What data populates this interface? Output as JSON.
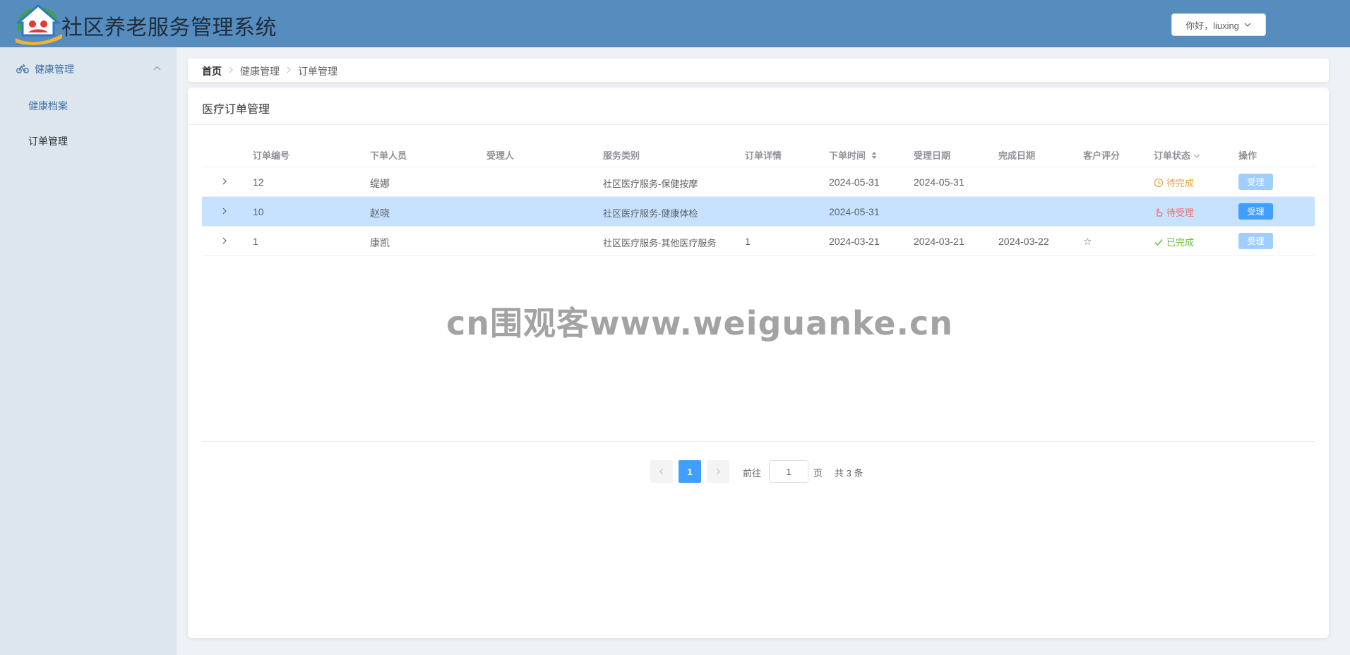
{
  "header": {
    "title": "社区养老服务管理系统",
    "user_greeting": "你好，liuxing",
    "bg_color": "#568cbe"
  },
  "sidebar": {
    "group_label": "健康管理",
    "group_icon": "bike-icon",
    "items": [
      {
        "label": "健康档案"
      },
      {
        "label": "订单管理"
      }
    ]
  },
  "breadcrumb": [
    "首页",
    "健康管理",
    "订单管理"
  ],
  "card": {
    "title": "医疗订单管理"
  },
  "table": {
    "columns": [
      "订单编号",
      "下单人员",
      "受理人",
      "服务类别",
      "订单详情",
      "下单时间",
      "受理日期",
      "完成日期",
      "客户评分",
      "订单状态",
      "操作"
    ],
    "rows": [
      {
        "id": "12",
        "customer": "缇娜",
        "handler": "",
        "category": "社区医疗服务-保健按摩",
        "detail": "",
        "order_time": "2024-05-31",
        "accept_date": "2024-05-31",
        "finish_date": "",
        "rating": "",
        "status": "待完成",
        "status_color": "#e6a23c",
        "action": "受理"
      },
      {
        "id": "10",
        "customer": "赵晓",
        "handler": "",
        "category": "社区医疗服务-健康体检",
        "detail": "",
        "order_time": "2024-05-31",
        "accept_date": "",
        "finish_date": "",
        "rating": "",
        "status": "待受理",
        "status_color": "#f56c6c",
        "action": "受理"
      },
      {
        "id": "1",
        "customer": "康凯",
        "handler": "",
        "category": "社区医疗服务-其他医疗服务",
        "detail": "1",
        "order_time": "2024-03-21",
        "accept_date": "2024-03-21",
        "finish_date": "2024-03-22",
        "rating": "☆",
        "status": "已完成",
        "status_color": "#67c23a",
        "action": "受理"
      }
    ]
  },
  "pagination": {
    "current_page": "1",
    "goto_label": "前往",
    "goto_value": "1",
    "page_unit": "页",
    "total_label": "共 3 条"
  },
  "watermark": "cn围观客www.weiguanke.cn"
}
